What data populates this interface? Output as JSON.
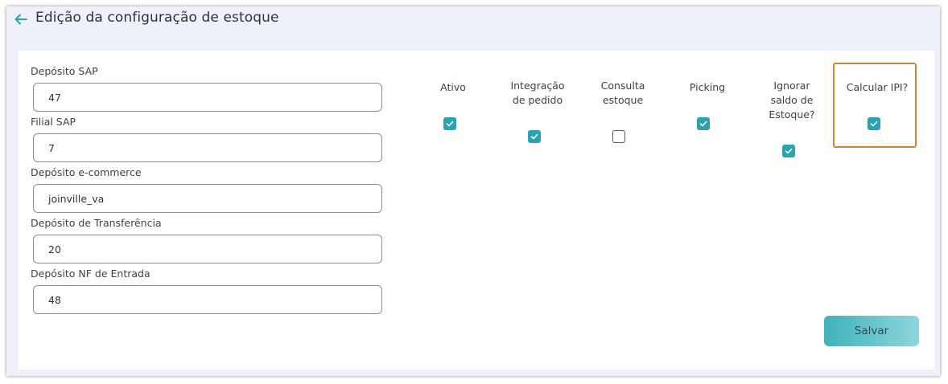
{
  "header": {
    "title": "Edição da configuração de estoque"
  },
  "form": {
    "fields": [
      {
        "label": "Depósito SAP",
        "value": "47"
      },
      {
        "label": "Filial SAP",
        "value": "7"
      },
      {
        "label": "Depósito e-commerce",
        "value": "joinville_va"
      },
      {
        "label": "Depósito de Transferência",
        "value": "20"
      },
      {
        "label": "Depósito NF de Entrada",
        "value": "48"
      }
    ]
  },
  "options": [
    {
      "line1": "Ativo",
      "line2": "",
      "line3": "",
      "checked": true
    },
    {
      "line1": "Integração",
      "line2": "de pedido",
      "line3": "",
      "checked": true
    },
    {
      "line1": "Consulta",
      "line2": "estoque",
      "line3": "",
      "checked": false
    },
    {
      "line1": "Picking",
      "line2": "",
      "line3": "",
      "checked": true
    },
    {
      "line1": "Ignorar",
      "line2": "saldo de",
      "line3": "Estoque?",
      "checked": true
    },
    {
      "line1": "Calcular IPI?",
      "line2": "",
      "line3": "",
      "checked": true
    }
  ],
  "actions": {
    "save_label": "Salvar"
  },
  "colors": {
    "accent": "#2aa3b0",
    "highlight": "#d6852a"
  }
}
